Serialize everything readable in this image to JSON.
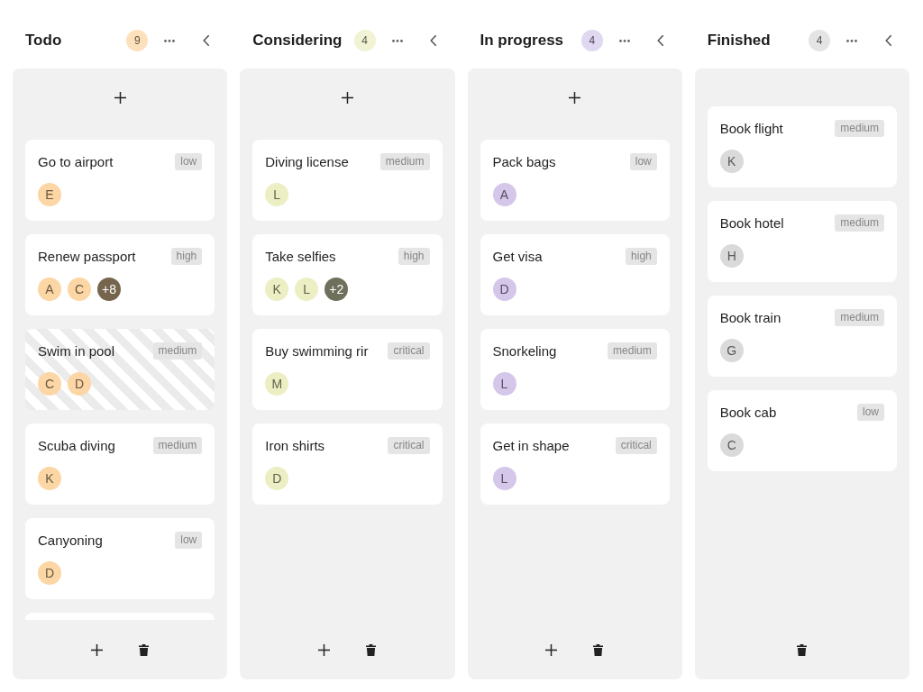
{
  "columns": [
    {
      "title": "Todo",
      "count": "9",
      "color": "#fcd6a4",
      "can_add": true,
      "more_below": true,
      "cards": [
        {
          "title": "Go to airport",
          "priority": "low",
          "striped": false,
          "avatars": [
            {
              "kind": "initial",
              "label": "E"
            }
          ]
        },
        {
          "title": "Renew passport",
          "priority": "high",
          "striped": false,
          "avatars": [
            {
              "kind": "initial",
              "label": "A"
            },
            {
              "kind": "initial",
              "label": "C"
            },
            {
              "kind": "more",
              "label": "+8"
            }
          ]
        },
        {
          "title": "Swim in pool",
          "priority": "medium",
          "striped": true,
          "avatars": [
            {
              "kind": "initial",
              "label": "C"
            },
            {
              "kind": "initial",
              "label": "D"
            }
          ]
        },
        {
          "title": "Scuba diving",
          "priority": "medium",
          "striped": false,
          "avatars": [
            {
              "kind": "initial",
              "label": "K"
            }
          ]
        },
        {
          "title": "Canyoning",
          "priority": "low",
          "striped": false,
          "avatars": [
            {
              "kind": "initial",
              "label": "D"
            }
          ]
        }
      ]
    },
    {
      "title": "Considering",
      "count": "4",
      "color": "#ecefc3",
      "can_add": true,
      "more_below": false,
      "cards": [
        {
          "title": "Diving license",
          "priority": "medium",
          "striped": false,
          "avatars": [
            {
              "kind": "initial",
              "label": "L"
            }
          ]
        },
        {
          "title": "Take selfies",
          "priority": "high",
          "striped": false,
          "avatars": [
            {
              "kind": "initial",
              "label": "K"
            },
            {
              "kind": "initial",
              "label": "L"
            },
            {
              "kind": "more",
              "label": "+2"
            }
          ]
        },
        {
          "title": "Buy swimming rir",
          "priority": "critical",
          "striped": false,
          "avatars": [
            {
              "kind": "initial",
              "label": "M"
            }
          ]
        },
        {
          "title": "Iron shirts",
          "priority": "critical",
          "striped": false,
          "avatars": [
            {
              "kind": "initial",
              "label": "D"
            }
          ]
        }
      ]
    },
    {
      "title": "In progress",
      "count": "4",
      "color": "#d4c7ea",
      "can_add": true,
      "more_below": false,
      "cards": [
        {
          "title": "Pack bags",
          "priority": "low",
          "striped": false,
          "avatars": [
            {
              "kind": "initial",
              "label": "A"
            }
          ]
        },
        {
          "title": "Get visa",
          "priority": "high",
          "striped": false,
          "avatars": [
            {
              "kind": "initial",
              "label": "D"
            }
          ]
        },
        {
          "title": "Snorkeling",
          "priority": "medium",
          "striped": false,
          "avatars": [
            {
              "kind": "initial",
              "label": "L"
            }
          ]
        },
        {
          "title": "Get in shape",
          "priority": "critical",
          "striped": false,
          "avatars": [
            {
              "kind": "initial",
              "label": "L"
            }
          ]
        }
      ]
    },
    {
      "title": "Finished",
      "count": "4",
      "color": "#dadada",
      "can_add": false,
      "more_below": false,
      "cards": [
        {
          "title": "Book flight",
          "priority": "medium",
          "striped": false,
          "avatars": [
            {
              "kind": "initial",
              "label": "K"
            }
          ]
        },
        {
          "title": "Book hotel",
          "priority": "medium",
          "striped": false,
          "avatars": [
            {
              "kind": "initial",
              "label": "H"
            }
          ]
        },
        {
          "title": "Book train",
          "priority": "medium",
          "striped": false,
          "avatars": [
            {
              "kind": "initial",
              "label": "G"
            }
          ]
        },
        {
          "title": "Book cab",
          "priority": "low",
          "striped": false,
          "avatars": [
            {
              "kind": "initial",
              "label": "C"
            }
          ]
        }
      ]
    }
  ]
}
